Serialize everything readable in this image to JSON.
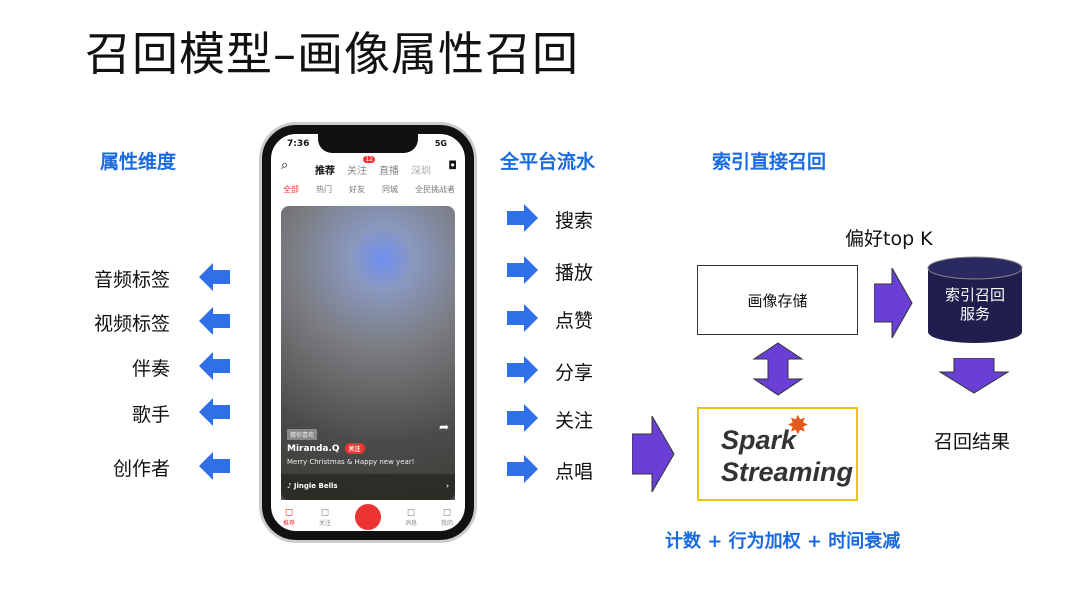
{
  "title": "召回模型–画像属性召回",
  "colors": {
    "heading": "#1a6be0",
    "blue_arrow": "#2f6fe8",
    "purple_arrow": "#6a3fd6",
    "cylinder": "#1f1e4d",
    "spark_border": "#e8c417"
  },
  "attributes": {
    "heading": "属性维度",
    "items": [
      "音频标签",
      "视频标签",
      "伴奏",
      "歌手",
      "创作者"
    ]
  },
  "stream": {
    "heading": "全平台流水",
    "items": [
      "搜索",
      "播放",
      "点赞",
      "分享",
      "关注",
      "点唱"
    ]
  },
  "recall": {
    "heading": "索引直接召回",
    "topk": "偏好top K",
    "profile_store": "画像存储",
    "index_service": "索引召回\n服务",
    "result": "召回结果",
    "spark_line1": "Spark",
    "spark_line2": "Streaming",
    "formula": "计数 + 行为加权 + 时间衰减"
  },
  "phone": {
    "time": "7:36",
    "signal": "5G",
    "tabs": [
      "推荐",
      "关注",
      "直播",
      "深圳"
    ],
    "badge": "12",
    "subtabs": [
      "全部",
      "热门",
      "好友",
      "同城",
      "全民挑战者"
    ],
    "tag": "猜你喜欢",
    "user": "Miranda.Q",
    "follow": "关注",
    "caption": "Merry Christmas & Happy new year!",
    "song": "Jingle Bells",
    "nav": [
      "推荐",
      "关注",
      "",
      "消息",
      "我的"
    ]
  }
}
